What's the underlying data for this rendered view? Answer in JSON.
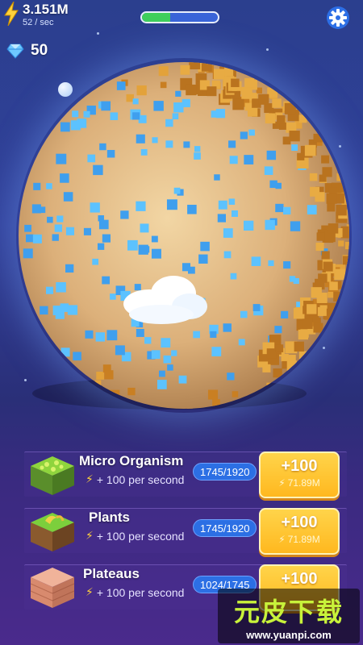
{
  "hud": {
    "energy_value": "3.151M",
    "energy_rate": "52 / sec",
    "gem_count": "50",
    "progress_fraction": 0.37
  },
  "colors": {
    "accent": "#ffb81f",
    "progress_fill": "#3fcf5b",
    "pill": "#2c6fe4"
  },
  "icons": {
    "energy": "lightning-bolt-icon",
    "gem": "diamond-icon",
    "settings": "gear-icon"
  },
  "upgrades": [
    {
      "name": "Micro Organism",
      "rate": "+ 100 per second",
      "count": "1745/1920",
      "button_label": "+100",
      "cost": "71.89M",
      "tile": "moss-tile-icon"
    },
    {
      "name": "Plants",
      "rate": "+ 100 per second",
      "count": "1745/1920",
      "button_label": "+100",
      "cost": "71.89M",
      "tile": "grass-tile-icon"
    },
    {
      "name": "Plateaus",
      "rate": "+ 100 per second",
      "count": "1024/1745",
      "button_label": "+100",
      "cost": "",
      "tile": "rock-tile-icon"
    }
  ],
  "watermark": {
    "title": "元皮下载",
    "url": "www.yuanpi.com"
  }
}
